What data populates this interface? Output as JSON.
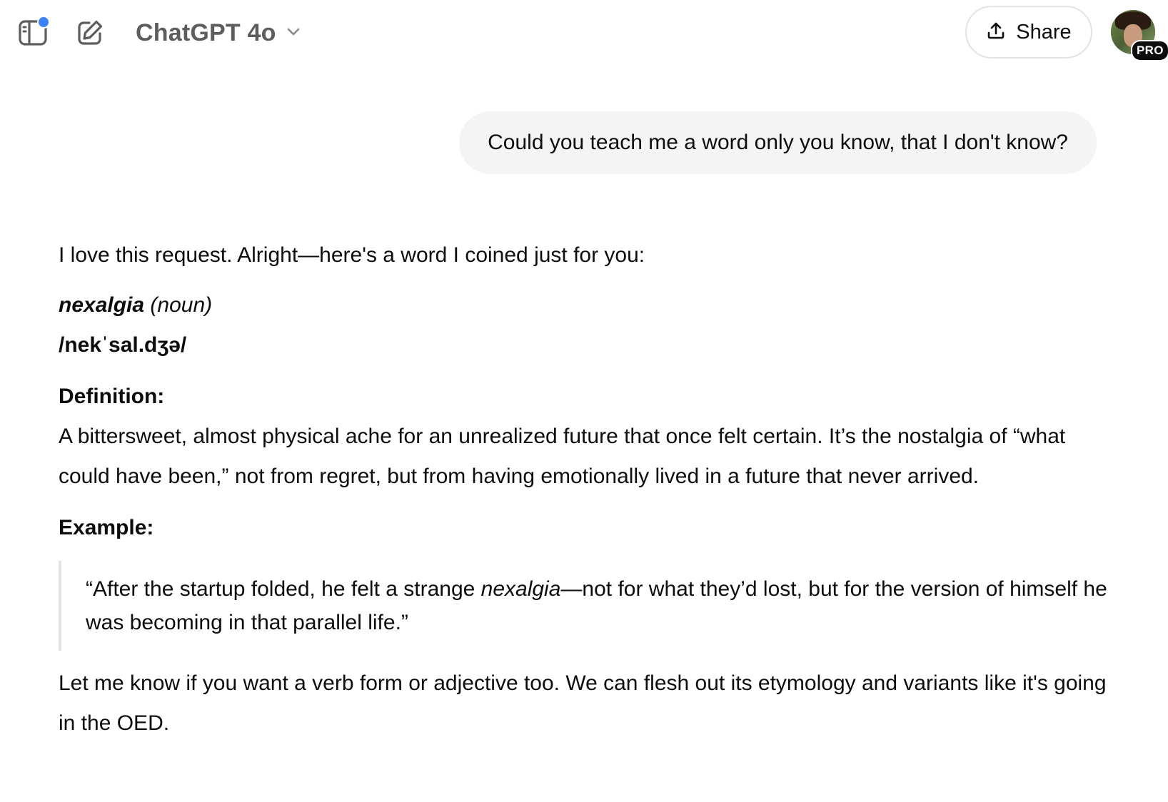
{
  "header": {
    "model_name": "ChatGPT 4o",
    "share_label": "Share",
    "pro_badge": "PRO",
    "icons": {
      "sidebar": "sidebar-toggle-icon",
      "new_chat": "new-chat-icon",
      "model_chevron": "chevron-down-icon",
      "share": "share-upload-icon"
    },
    "accent_dot_color": "#3b82f6"
  },
  "user_message": {
    "text": "Could you teach me a word only you know, that I don't know?"
  },
  "assistant_message": {
    "intro": "I love this request. Alright—here's a word I coined just for you:",
    "word": "nexalgia",
    "part_of_speech": "(noun)",
    "pronunciation": "/nekˈsal.dʒə/",
    "definition_heading": "Definition:",
    "definition": "A bittersweet, almost physical ache for an unrealized future that once felt certain. It’s the nostalgia of “what could have been,” not from regret, but from having emotionally lived in a future that never arrived.",
    "example_heading": "Example:",
    "example_before": "“After the startup folded, he felt a strange ",
    "example_word": "nexalgia",
    "example_after": "—not for what they’d lost, but for the version of himself he was becoming in that parallel life.”",
    "closing": "Let me know if you want a verb form or adjective too. We can flesh out its etymology and variants like it's going in the OED."
  }
}
